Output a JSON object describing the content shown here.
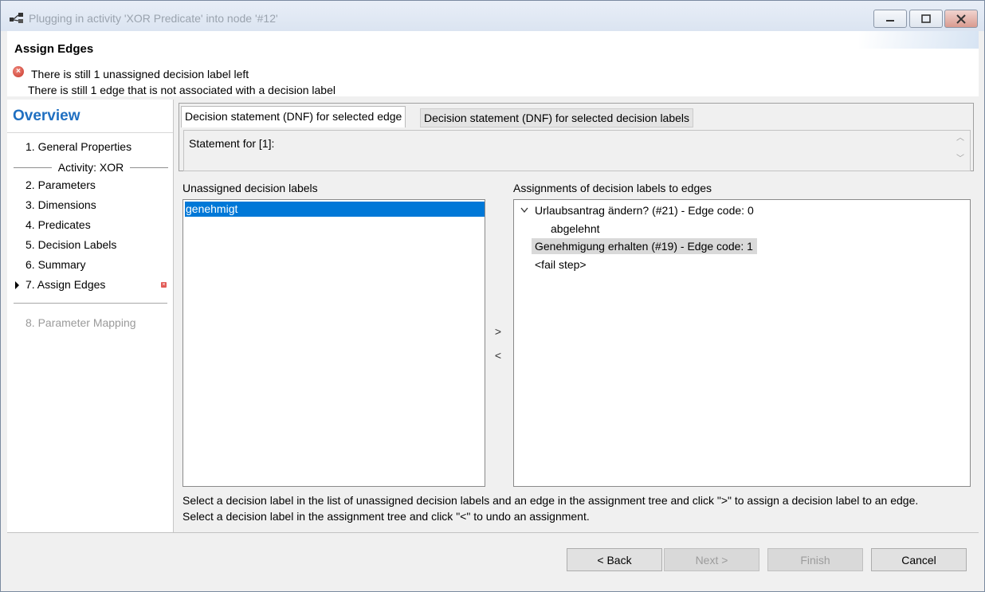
{
  "window": {
    "title": "Plugging in activity 'XOR Predicate' into node '#12'"
  },
  "header": {
    "title": "Assign Edges",
    "messages": [
      "There is still 1 unassigned decision label left",
      "There is still 1 edge that is not associated with a decision label"
    ]
  },
  "nav": {
    "title": "Overview",
    "group_label": "Activity: XOR",
    "items": [
      {
        "label": "1.  General Properties"
      },
      {
        "label": "2.  Parameters"
      },
      {
        "label": "3.  Dimensions"
      },
      {
        "label": "4.  Predicates"
      },
      {
        "label": "5.  Decision Labels"
      },
      {
        "label": "6.  Summary"
      },
      {
        "label": "7.  Assign Edges"
      },
      {
        "label": "8.  Parameter Mapping"
      }
    ],
    "current_item": "7.  Assign Edges"
  },
  "tabs": [
    {
      "label": "Decision statement (DNF) for selected edge",
      "active": true
    },
    {
      "label": "Decision statement (DNF) for selected decision labels",
      "active": false
    }
  ],
  "statement": {
    "text": "Statement for [1]:"
  },
  "unassigned": {
    "heading": "Unassigned decision labels",
    "items": [
      "genehmigt"
    ]
  },
  "move": {
    "assign": ">",
    "unassign": "<"
  },
  "assignments": {
    "heading": "Assignments of decision labels to edges",
    "tree": [
      {
        "label": "Urlaubsantrag ändern? (#21) - Edge code: 0",
        "expanded": true,
        "children": [
          "abgelehnt"
        ]
      },
      {
        "label": "Genehmigung erhalten (#19) - Edge code: 1",
        "selected": true
      },
      {
        "label": "<fail step>"
      }
    ]
  },
  "hints": [
    "Select a decision label in the list of unassigned decision labels and an edge in the assignment tree and click \">\" to assign a decision label to an edge.",
    "Select a decision label in the assignment tree and click \"<\" to undo an assignment."
  ],
  "buttons": {
    "back": "< Back",
    "next": "Next >",
    "finish": "Finish",
    "cancel": "Cancel"
  },
  "colors": {
    "accent": "#1f6fc1",
    "selection": "#0078d7",
    "error": "#c8362a"
  }
}
